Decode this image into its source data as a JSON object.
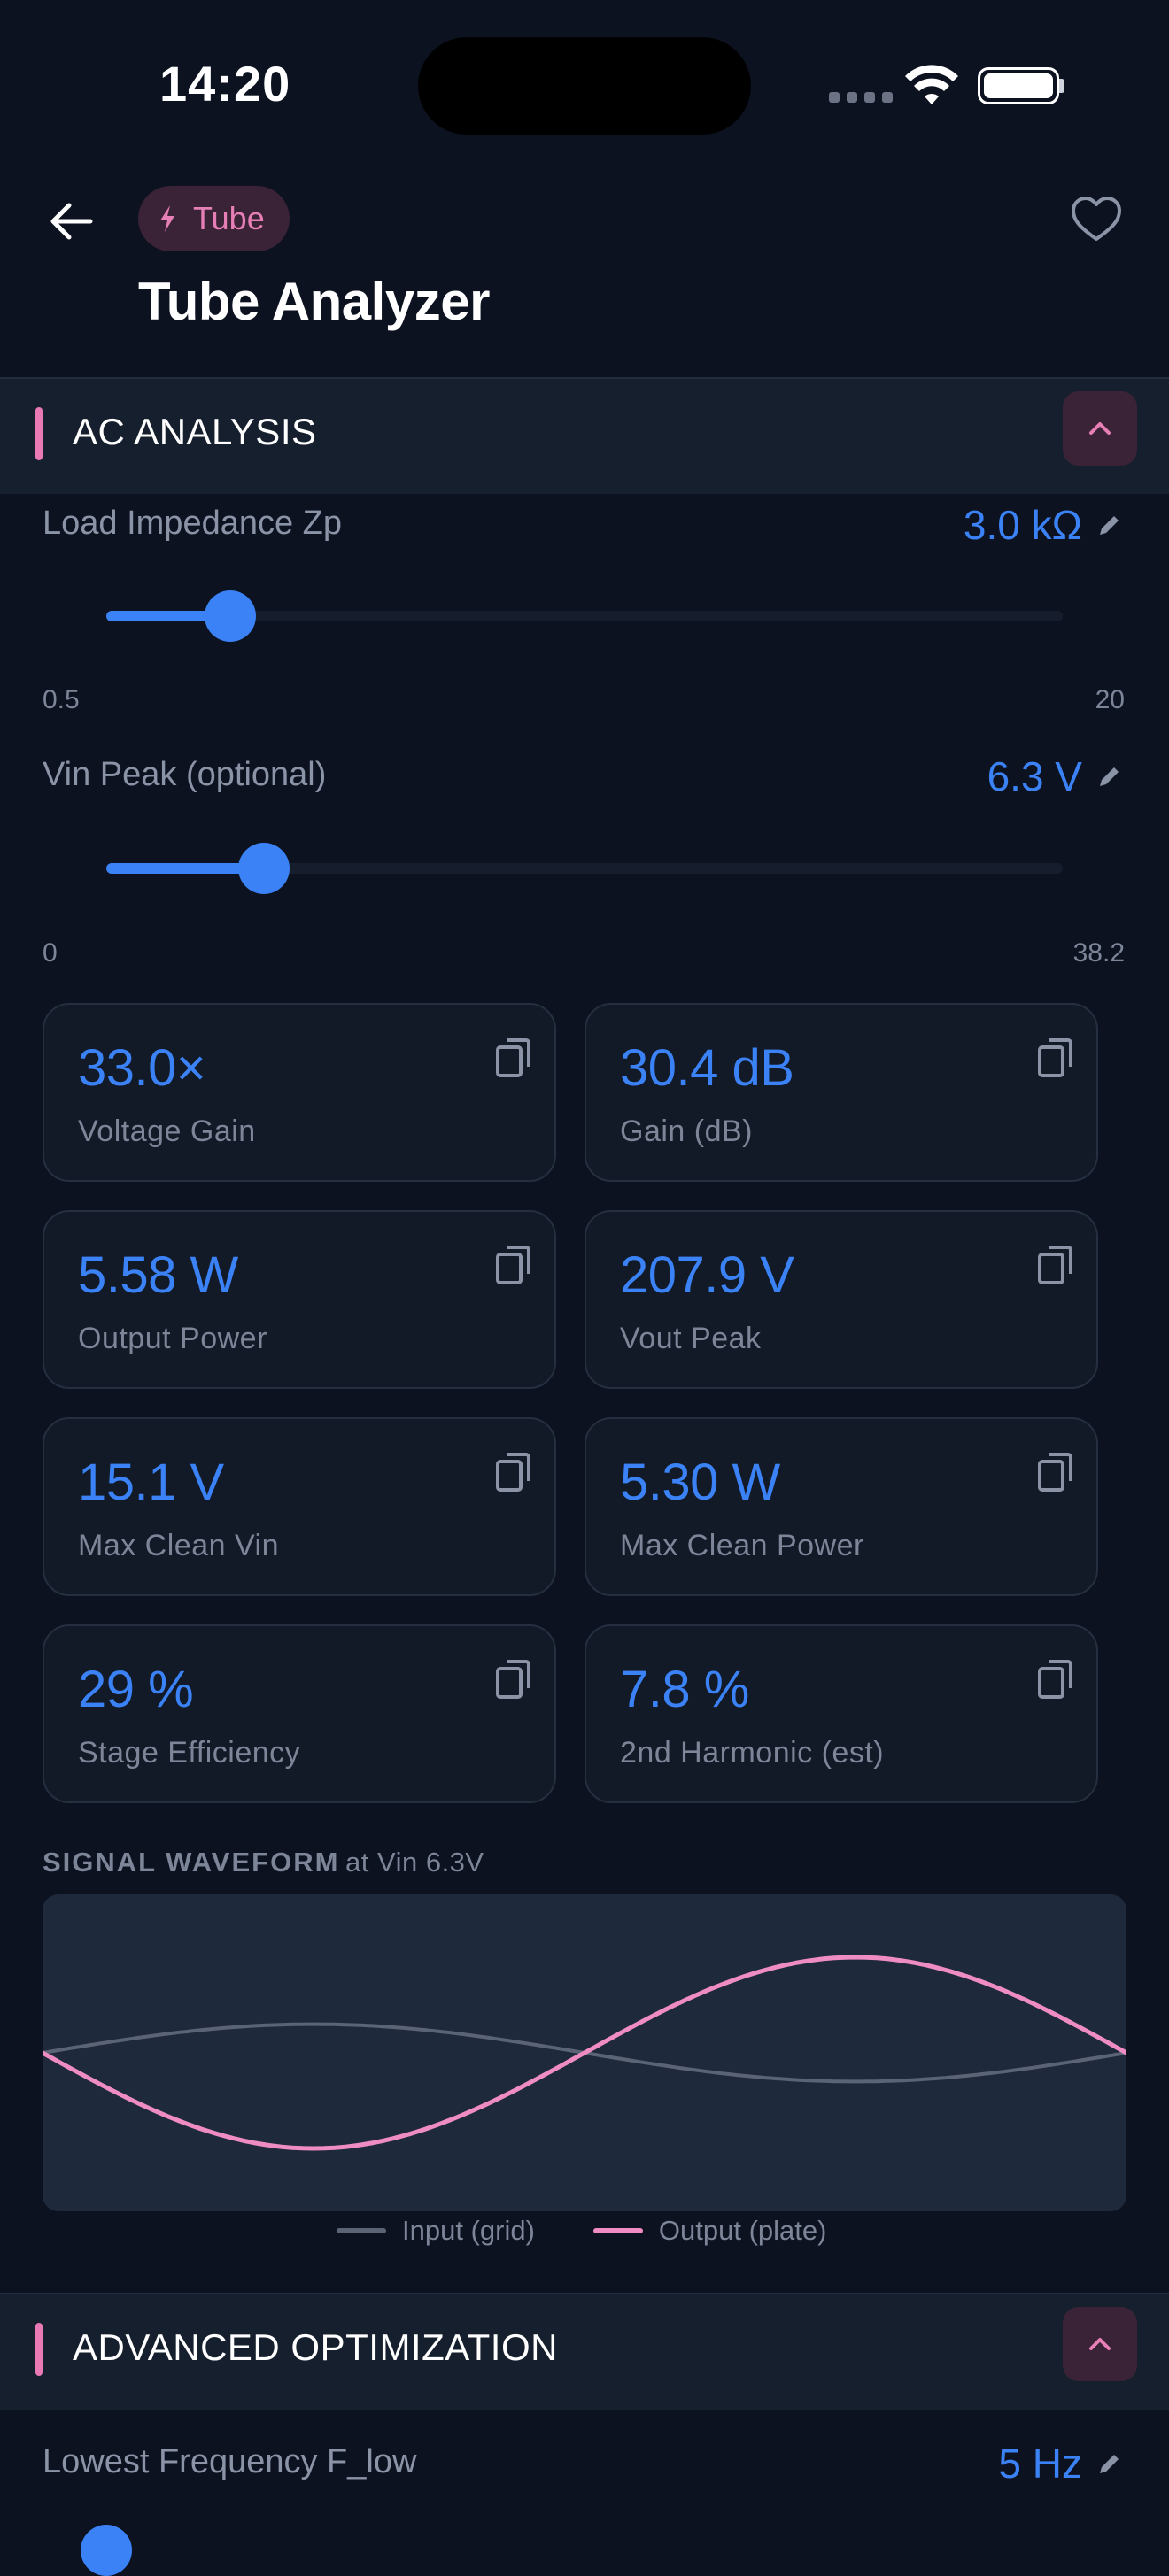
{
  "status_bar": {
    "time": "14:20"
  },
  "header": {
    "chip_label": "Tube",
    "title": "Tube Analyzer"
  },
  "ac_section": {
    "title": "AC ANALYSIS",
    "sliders": [
      {
        "label": "Load Impedance Zp",
        "value": "3.0 kΩ",
        "min": "0.5",
        "max": "20",
        "fraction": 0.13
      },
      {
        "label": "Vin Peak (optional)",
        "value": "6.3 V",
        "min": "0",
        "max": "38.2",
        "fraction": 0.165
      }
    ],
    "metrics": [
      {
        "value": "33.0×",
        "label": "Voltage Gain"
      },
      {
        "value": "30.4 dB",
        "label": "Gain (dB)"
      },
      {
        "value": "5.58 W",
        "label": "Output Power"
      },
      {
        "value": "207.9 V",
        "label": "Vout Peak"
      },
      {
        "value": "15.1 V",
        "label": "Max Clean Vin"
      },
      {
        "value": "5.30 W",
        "label": "Max Clean Power"
      },
      {
        "value": "29 %",
        "label": "Stage Efficiency"
      },
      {
        "value": "7.8 %",
        "label": "2nd Harmonic (est)"
      }
    ]
  },
  "waveform": {
    "title": "SIGNAL WAVEFORM",
    "subtitle": "at Vin 6.3V",
    "legend": [
      {
        "name": "Input (grid)",
        "color": "#5b6475"
      },
      {
        "name": "Output (plate)",
        "color": "#f08cc4"
      }
    ],
    "input_amplitude": 0.3,
    "output_amplitude": 1.0
  },
  "advanced_section": {
    "title": "ADVANCED OPTIMIZATION",
    "slider": {
      "label": "Lowest Frequency F_low",
      "value": "5 Hz"
    }
  },
  "colors": {
    "accent_blue": "#3b82f6",
    "accent_pink": "#e879b5",
    "background": "#0d1221"
  }
}
